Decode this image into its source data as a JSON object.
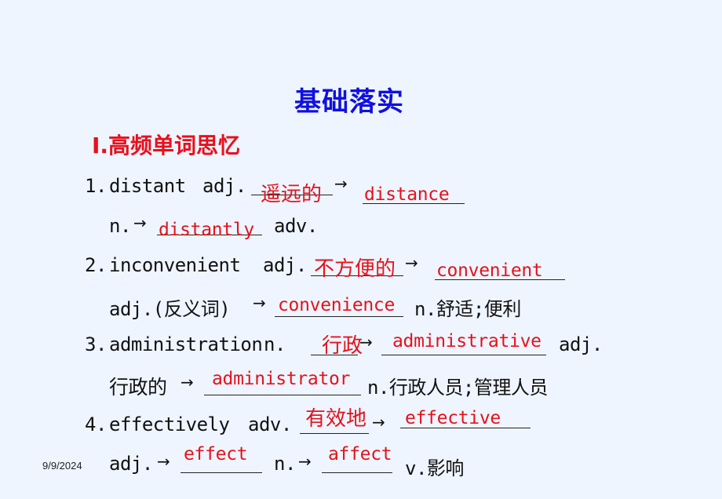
{
  "slide": {
    "title": "基础落实",
    "section_heading": "Ⅰ.高频单词思忆",
    "date": "9/9/2024",
    "colors": {
      "title": "#1010e0",
      "heading": "#e8101c",
      "answer": "#e5121c",
      "text": "#111111",
      "background": "#eef5fe"
    }
  },
  "items": [
    {
      "number": "1.",
      "word": "distant",
      "pos": "adj.",
      "answer_meaning": "遥远的",
      "answer_form1": "distance",
      "line2_prefix": "n.",
      "answer_form2": "distantly",
      "line2_suffix": "adv."
    },
    {
      "number": "2.",
      "word": "inconvenient",
      "pos": "adj.",
      "answer_meaning": "不方便的",
      "answer_form1": "convenient",
      "line2_prefix": "adj.(反义词)",
      "answer_form2": "convenience",
      "line2_suffix": "n.舒适;便利"
    },
    {
      "number": "3.",
      "word": "administration",
      "pos": "n.",
      "answer_meaning": "行政",
      "answer_form1": "administrative",
      "line1_suffix": "adj.",
      "line2_prefix": "行政的",
      "answer_form2": "administrator",
      "line2_suffix": "n.行政人员;管理人员"
    },
    {
      "number": "4.",
      "word": "effectively",
      "pos": "adv.",
      "answer_meaning": "有效地",
      "answer_form1": "effective",
      "line2_prefix": "adj.",
      "answer_form2": "effect",
      "line2_mid": "n.",
      "answer_form3": "affect",
      "line2_suffix": "v.影响"
    }
  ],
  "icons": {
    "arrow": "→"
  }
}
